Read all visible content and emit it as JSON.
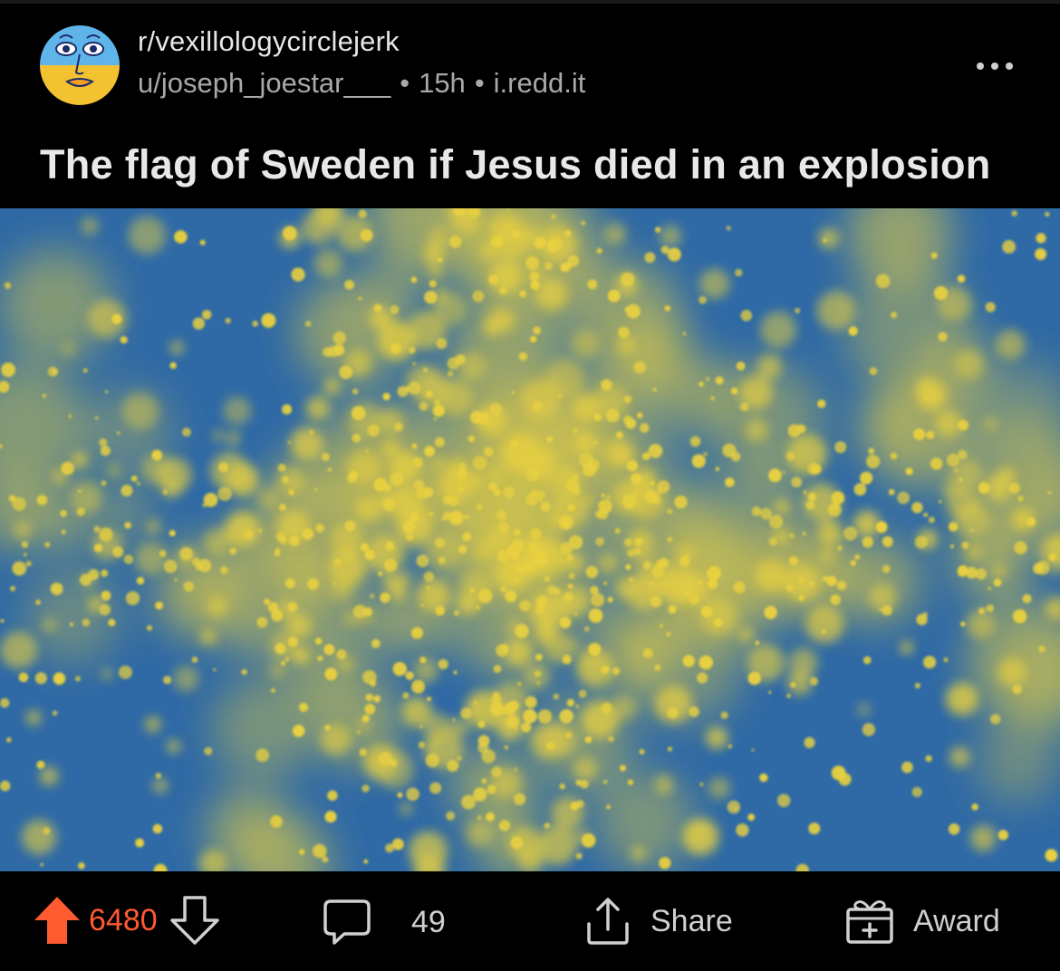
{
  "post": {
    "subreddit": "r/vexillologycirclejerk",
    "author": "u/joseph_joestar___",
    "age": "15h",
    "domain": "i.redd.it",
    "separator": "•",
    "title": "The flag of Sweden if Jesus died in an explosion"
  },
  "actions": {
    "votes": "6480",
    "comments": "49",
    "share_label": "Share",
    "award_label": "Award"
  },
  "colors": {
    "background": "#000000",
    "upvote_active": "#ff5a30",
    "flag_blue": "#2f6aa6",
    "flag_yellow": "#e8d040"
  },
  "icons": {
    "avatar": "subreddit-avatar-face",
    "more": "ellipsis-icon",
    "upvote": "upvote-arrow-icon",
    "downvote": "downvote-arrow-icon",
    "comment": "comment-bubble-icon",
    "share": "share-icon",
    "award": "gift-icon"
  }
}
